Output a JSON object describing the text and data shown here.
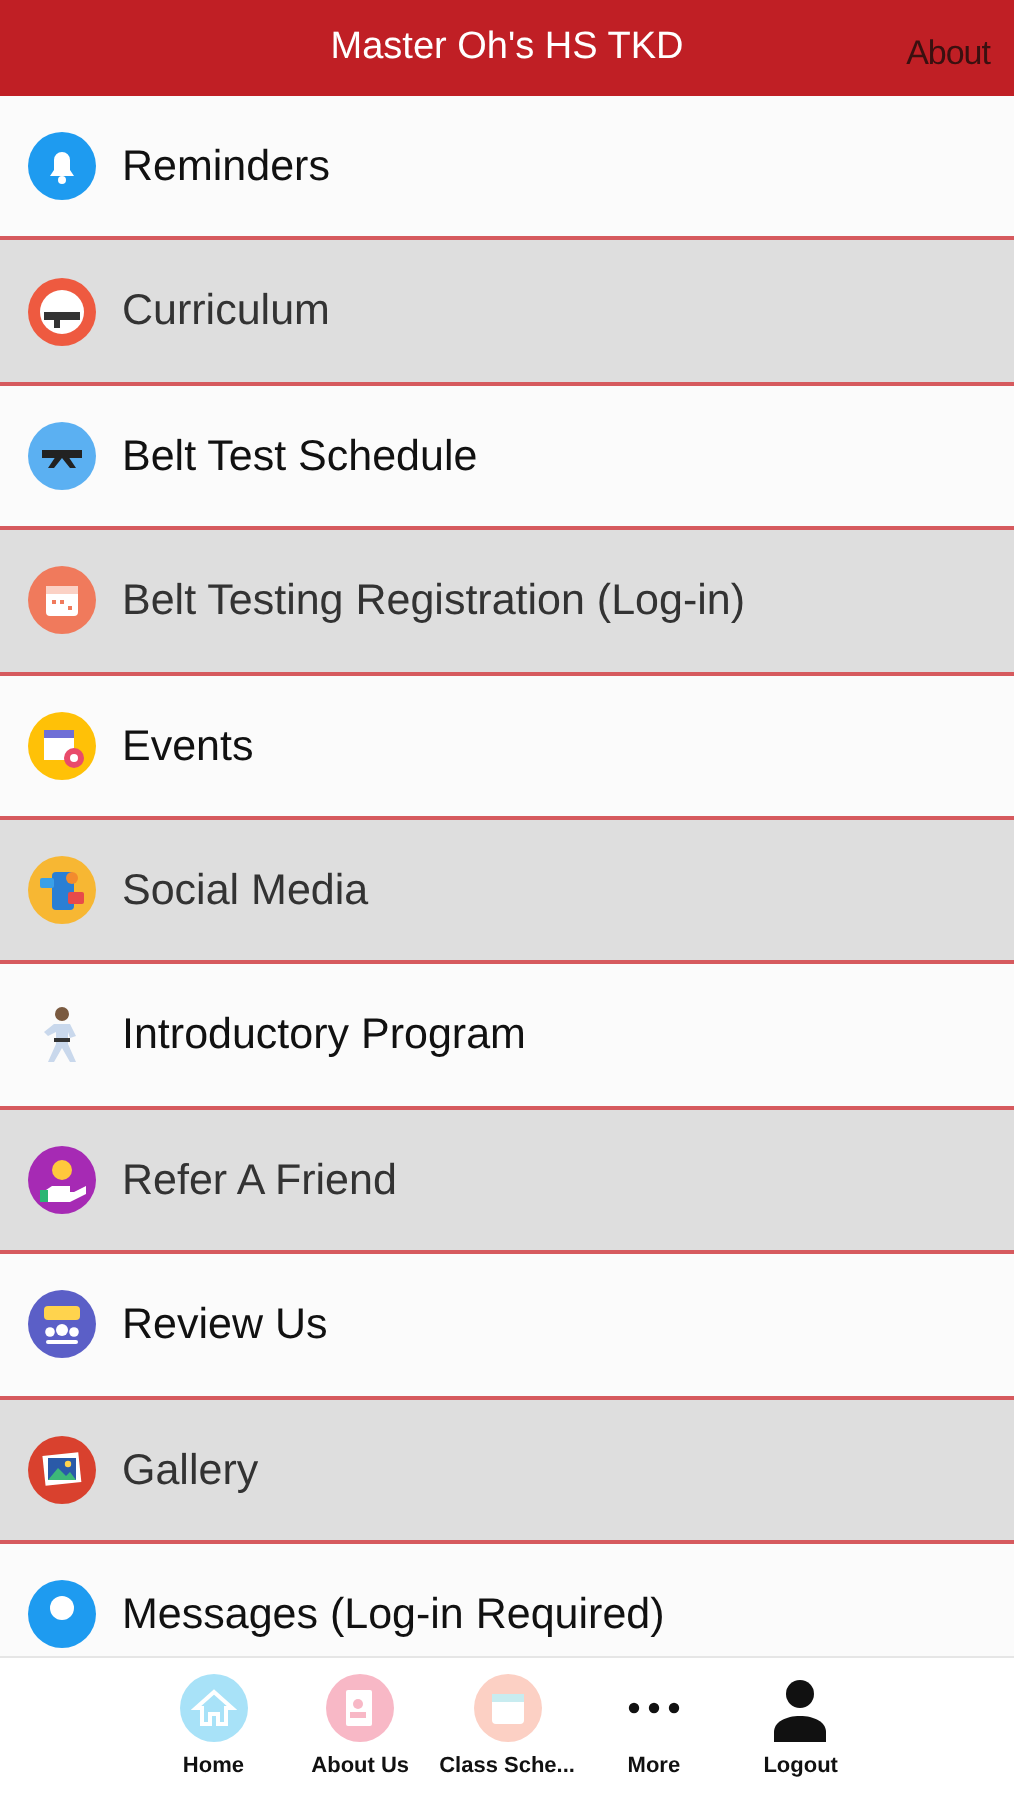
{
  "header": {
    "title": "Master Oh's HS TKD",
    "action": "About"
  },
  "menu": [
    {
      "label": "Reminders"
    },
    {
      "label": "Curriculum"
    },
    {
      "label": "Belt Test Schedule"
    },
    {
      "label": "Belt Testing Registration (Log-in)"
    },
    {
      "label": "Events"
    },
    {
      "label": "Social Media"
    },
    {
      "label": "Introductory Program"
    },
    {
      "label": "Refer A Friend"
    },
    {
      "label": "Review Us"
    },
    {
      "label": "Gallery"
    },
    {
      "label": "Messages (Log-in Required)"
    }
  ],
  "tab_bar": [
    {
      "label": "Home"
    },
    {
      "label": "About Us"
    },
    {
      "label": "Class Sche..."
    },
    {
      "label": "More"
    },
    {
      "label": "Logout"
    }
  ]
}
